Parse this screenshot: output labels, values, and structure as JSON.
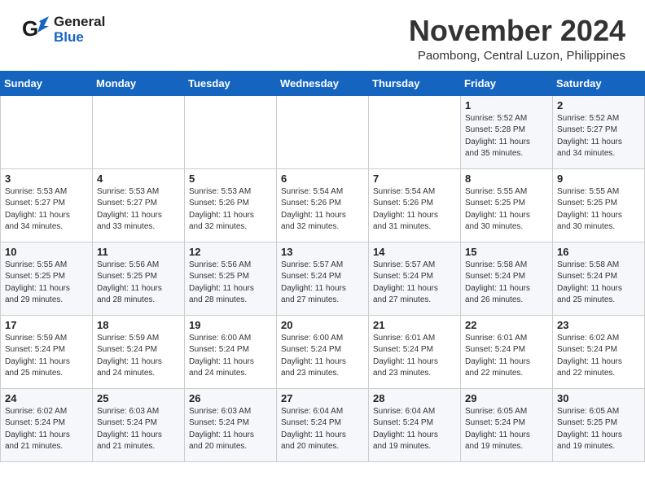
{
  "header": {
    "logo_line1": "General",
    "logo_line2": "Blue",
    "month_year": "November 2024",
    "location": "Paombong, Central Luzon, Philippines"
  },
  "days_of_week": [
    "Sunday",
    "Monday",
    "Tuesday",
    "Wednesday",
    "Thursday",
    "Friday",
    "Saturday"
  ],
  "weeks": [
    [
      {
        "day": "",
        "info": ""
      },
      {
        "day": "",
        "info": ""
      },
      {
        "day": "",
        "info": ""
      },
      {
        "day": "",
        "info": ""
      },
      {
        "day": "",
        "info": ""
      },
      {
        "day": "1",
        "info": "Sunrise: 5:52 AM\nSunset: 5:28 PM\nDaylight: 11 hours\nand 35 minutes."
      },
      {
        "day": "2",
        "info": "Sunrise: 5:52 AM\nSunset: 5:27 PM\nDaylight: 11 hours\nand 34 minutes."
      }
    ],
    [
      {
        "day": "3",
        "info": "Sunrise: 5:53 AM\nSunset: 5:27 PM\nDaylight: 11 hours\nand 34 minutes."
      },
      {
        "day": "4",
        "info": "Sunrise: 5:53 AM\nSunset: 5:27 PM\nDaylight: 11 hours\nand 33 minutes."
      },
      {
        "day": "5",
        "info": "Sunrise: 5:53 AM\nSunset: 5:26 PM\nDaylight: 11 hours\nand 32 minutes."
      },
      {
        "day": "6",
        "info": "Sunrise: 5:54 AM\nSunset: 5:26 PM\nDaylight: 11 hours\nand 32 minutes."
      },
      {
        "day": "7",
        "info": "Sunrise: 5:54 AM\nSunset: 5:26 PM\nDaylight: 11 hours\nand 31 minutes."
      },
      {
        "day": "8",
        "info": "Sunrise: 5:55 AM\nSunset: 5:25 PM\nDaylight: 11 hours\nand 30 minutes."
      },
      {
        "day": "9",
        "info": "Sunrise: 5:55 AM\nSunset: 5:25 PM\nDaylight: 11 hours\nand 30 minutes."
      }
    ],
    [
      {
        "day": "10",
        "info": "Sunrise: 5:55 AM\nSunset: 5:25 PM\nDaylight: 11 hours\nand 29 minutes."
      },
      {
        "day": "11",
        "info": "Sunrise: 5:56 AM\nSunset: 5:25 PM\nDaylight: 11 hours\nand 28 minutes."
      },
      {
        "day": "12",
        "info": "Sunrise: 5:56 AM\nSunset: 5:25 PM\nDaylight: 11 hours\nand 28 minutes."
      },
      {
        "day": "13",
        "info": "Sunrise: 5:57 AM\nSunset: 5:24 PM\nDaylight: 11 hours\nand 27 minutes."
      },
      {
        "day": "14",
        "info": "Sunrise: 5:57 AM\nSunset: 5:24 PM\nDaylight: 11 hours\nand 27 minutes."
      },
      {
        "day": "15",
        "info": "Sunrise: 5:58 AM\nSunset: 5:24 PM\nDaylight: 11 hours\nand 26 minutes."
      },
      {
        "day": "16",
        "info": "Sunrise: 5:58 AM\nSunset: 5:24 PM\nDaylight: 11 hours\nand 25 minutes."
      }
    ],
    [
      {
        "day": "17",
        "info": "Sunrise: 5:59 AM\nSunset: 5:24 PM\nDaylight: 11 hours\nand 25 minutes."
      },
      {
        "day": "18",
        "info": "Sunrise: 5:59 AM\nSunset: 5:24 PM\nDaylight: 11 hours\nand 24 minutes."
      },
      {
        "day": "19",
        "info": "Sunrise: 6:00 AM\nSunset: 5:24 PM\nDaylight: 11 hours\nand 24 minutes."
      },
      {
        "day": "20",
        "info": "Sunrise: 6:00 AM\nSunset: 5:24 PM\nDaylight: 11 hours\nand 23 minutes."
      },
      {
        "day": "21",
        "info": "Sunrise: 6:01 AM\nSunset: 5:24 PM\nDaylight: 11 hours\nand 23 minutes."
      },
      {
        "day": "22",
        "info": "Sunrise: 6:01 AM\nSunset: 5:24 PM\nDaylight: 11 hours\nand 22 minutes."
      },
      {
        "day": "23",
        "info": "Sunrise: 6:02 AM\nSunset: 5:24 PM\nDaylight: 11 hours\nand 22 minutes."
      }
    ],
    [
      {
        "day": "24",
        "info": "Sunrise: 6:02 AM\nSunset: 5:24 PM\nDaylight: 11 hours\nand 21 minutes."
      },
      {
        "day": "25",
        "info": "Sunrise: 6:03 AM\nSunset: 5:24 PM\nDaylight: 11 hours\nand 21 minutes."
      },
      {
        "day": "26",
        "info": "Sunrise: 6:03 AM\nSunset: 5:24 PM\nDaylight: 11 hours\nand 20 minutes."
      },
      {
        "day": "27",
        "info": "Sunrise: 6:04 AM\nSunset: 5:24 PM\nDaylight: 11 hours\nand 20 minutes."
      },
      {
        "day": "28",
        "info": "Sunrise: 6:04 AM\nSunset: 5:24 PM\nDaylight: 11 hours\nand 19 minutes."
      },
      {
        "day": "29",
        "info": "Sunrise: 6:05 AM\nSunset: 5:24 PM\nDaylight: 11 hours\nand 19 minutes."
      },
      {
        "day": "30",
        "info": "Sunrise: 6:05 AM\nSunset: 5:25 PM\nDaylight: 11 hours\nand 19 minutes."
      }
    ]
  ]
}
